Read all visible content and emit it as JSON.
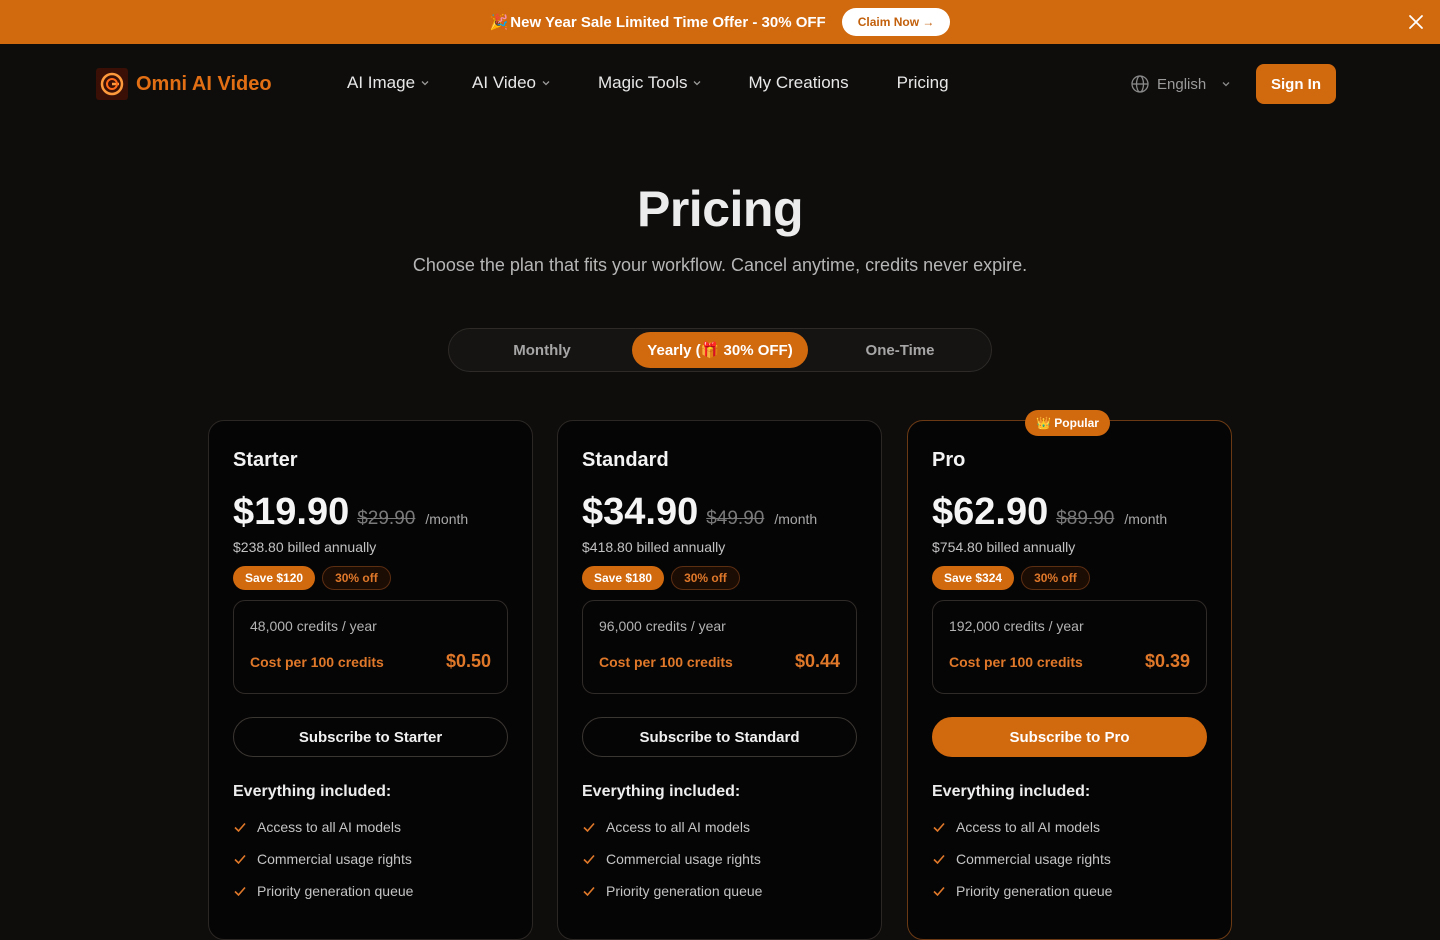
{
  "promo": {
    "emoji": "🎉",
    "text": "New Year Sale Limited Time Offer - 30% OFF",
    "cta": "Claim Now →"
  },
  "nav": {
    "brand": "Omni AI Video",
    "items": [
      {
        "label": "AI Image",
        "dropdown": true
      },
      {
        "label": "AI Video",
        "dropdown": true
      },
      {
        "label": "Magic Tools",
        "dropdown": true
      },
      {
        "label": "My Creations",
        "dropdown": false
      },
      {
        "label": "Pricing",
        "dropdown": false
      }
    ],
    "language": "English",
    "sign_in": "Sign In"
  },
  "header": {
    "title": "Pricing",
    "subtitle": "Choose the plan that fits your workflow. Cancel anytime, credits never expire."
  },
  "billing_tabs": {
    "items": [
      {
        "label": "Monthly",
        "active": false
      },
      {
        "label": "Yearly (🎁 30% OFF)",
        "active": true
      },
      {
        "label": "One-Time",
        "active": false
      }
    ]
  },
  "plans": [
    {
      "name": "Starter",
      "price": "$19.90",
      "old_price": "$29.90",
      "per": "/month",
      "billed": "$238.80 billed annually",
      "save": "Save $120",
      "discount": "30% off",
      "credits": "48,000 credits / year",
      "cost_label": "Cost per 100 credits",
      "cost_value": "$0.50",
      "cta": "Subscribe to Starter",
      "included_title": "Everything included:",
      "features": [
        "Access to all AI models",
        "Commercial usage rights",
        "Priority generation queue"
      ]
    },
    {
      "name": "Standard",
      "price": "$34.90",
      "old_price": "$49.90",
      "per": "/month",
      "billed": "$418.80 billed annually",
      "save": "Save $180",
      "discount": "30% off",
      "credits": "96,000 credits / year",
      "cost_label": "Cost per 100 credits",
      "cost_value": "$0.44",
      "cta": "Subscribe to Standard",
      "included_title": "Everything included:",
      "features": [
        "Access to all AI models",
        "Commercial usage rights",
        "Priority generation queue"
      ]
    },
    {
      "name": "Pro",
      "badge": "👑 Popular",
      "price": "$62.90",
      "old_price": "$89.90",
      "per": "/month",
      "billed": "$754.80 billed annually",
      "save": "Save $324",
      "discount": "30% off",
      "credits": "192,000 credits / year",
      "cost_label": "Cost per 100 credits",
      "cost_value": "$0.39",
      "cta": "Subscribe to Pro",
      "included_title": "Everything included:",
      "features": [
        "Access to all AI models",
        "Commercial usage rights",
        "Priority generation queue"
      ]
    }
  ],
  "colors": {
    "accent": "#d1690f",
    "accent_text": "#e0782a",
    "background": "#0e0d0c",
    "card_background": "#060505"
  },
  "icons": {
    "close": "close-icon",
    "logo": "logo-icon",
    "chevron": "chevron-down-icon",
    "globe": "globe-icon",
    "check": "check-icon"
  }
}
